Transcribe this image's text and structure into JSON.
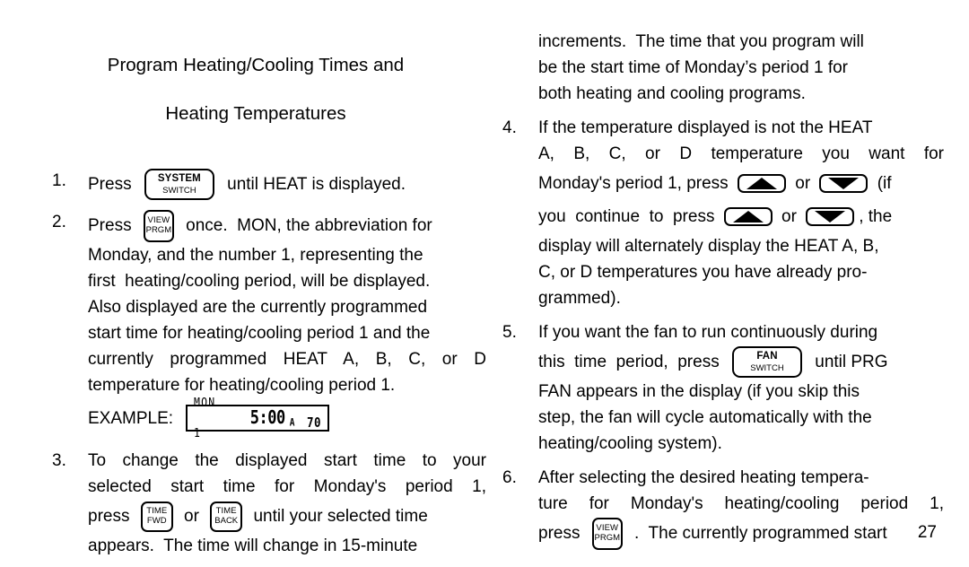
{
  "page": {
    "title_line1": "Program Heating/Cooling Times and",
    "title_line2": "Heating Temperatures",
    "page_number": "27"
  },
  "buttons": {
    "system_switch": {
      "line1": "SYSTEM",
      "line2": "SWITCH"
    },
    "view_prgm": {
      "line1": "VIEW",
      "line2": "PRGM"
    },
    "time_fwd": {
      "line1": "TIME",
      "line2": "FWD"
    },
    "time_back": {
      "line1": "TIME",
      "line2": "BACK"
    },
    "fan_switch": {
      "line1": "FAN",
      "line2": "SWITCH"
    },
    "arrow_up": "up-arrow",
    "arrow_down": "down-arrow"
  },
  "lcd_example": {
    "label": "EXAMPLE:",
    "day": "MON 1",
    "time": "5:00",
    "period": "A",
    "temperature": "70"
  },
  "steps": [
    {
      "number": "1.",
      "lines": [
        {
          "type": "mixed",
          "parts": [
            "Press ",
            "@system_switch",
            " until HEAT is displayed."
          ]
        }
      ]
    },
    {
      "number": "2.",
      "lines": [
        {
          "type": "mixed",
          "parts": [
            "Press ",
            "@view_prgm",
            " once.  MON, the abbreviation for"
          ]
        },
        {
          "type": "text",
          "text": "Monday, and the number 1, representing the"
        },
        {
          "type": "text",
          "text": "first  heating/cooling period, will be displayed."
        },
        {
          "type": "text",
          "text": "Also displayed are the currently programmed"
        },
        {
          "type": "text",
          "text": "start time for heating/cooling period 1 and the"
        },
        {
          "type": "justify",
          "text": "currently programmed HEAT A, B, C, or D"
        },
        {
          "type": "text",
          "text": "temperature for heating/cooling period 1."
        }
      ]
    },
    {
      "number": "3.",
      "lines": [
        {
          "type": "justify",
          "text": "To change the displayed start time to your"
        },
        {
          "type": "justify",
          "text": "selected start time for Monday's period 1,"
        },
        {
          "type": "mixed",
          "parts": [
            "press ",
            "@time_fwd",
            " or ",
            "@time_back",
            " until your selected time"
          ]
        },
        {
          "type": "text",
          "text": "appears.  The time will change in 15-minute"
        }
      ]
    },
    {
      "number": "",
      "lines": [
        {
          "type": "text",
          "text": "increments.  The time that you program will"
        },
        {
          "type": "text",
          "text": "be the start time of Monday’s period 1 for"
        },
        {
          "type": "text",
          "text": "both heating and cooling programs."
        }
      ]
    },
    {
      "number": "4.",
      "lines": [
        {
          "type": "text",
          "text": "If the temperature displayed is not the HEAT"
        },
        {
          "type": "justify",
          "text": "A, B, C, or D temperature you want for"
        },
        {
          "type": "mixed",
          "parts": [
            "Monday's period 1, press ",
            "@arrow_up",
            " or ",
            "@arrow_down",
            " (if"
          ]
        },
        {
          "type": "mixed",
          "parts": [
            "you  continue  to  press ",
            "@arrow_up",
            " or ",
            "@arrow_down",
            ", the"
          ]
        },
        {
          "type": "text",
          "text": "display will alternately display the HEAT A, B,"
        },
        {
          "type": "text",
          "text": "C, or D temperatures you have already pro-"
        },
        {
          "type": "text",
          "text": "grammed)."
        }
      ]
    },
    {
      "number": "5.",
      "lines": [
        {
          "type": "text",
          "text": "If you want the fan to run continuously during"
        },
        {
          "type": "mixed",
          "parts": [
            "this  time  period,  press ",
            "@fan_switch",
            " until PRG"
          ]
        },
        {
          "type": "text",
          "text": "FAN appears in the display (if you skip this"
        },
        {
          "type": "text",
          "text": "step, the fan will cycle automatically with the"
        },
        {
          "type": "text",
          "text": "heating/cooling system)."
        }
      ]
    },
    {
      "number": "6.",
      "lines": [
        {
          "type": "text",
          "text": "After selecting the desired heating tempera-"
        },
        {
          "type": "justify",
          "text": "ture for Monday's heating/cooling period 1,"
        },
        {
          "type": "mixed",
          "parts": [
            "press ",
            "@view_prgm",
            " .  The currently programmed start"
          ]
        }
      ]
    }
  ],
  "column_split": {
    "left_steps": [
      0,
      1,
      2
    ],
    "right_steps": [
      3,
      4,
      5,
      6
    ]
  }
}
